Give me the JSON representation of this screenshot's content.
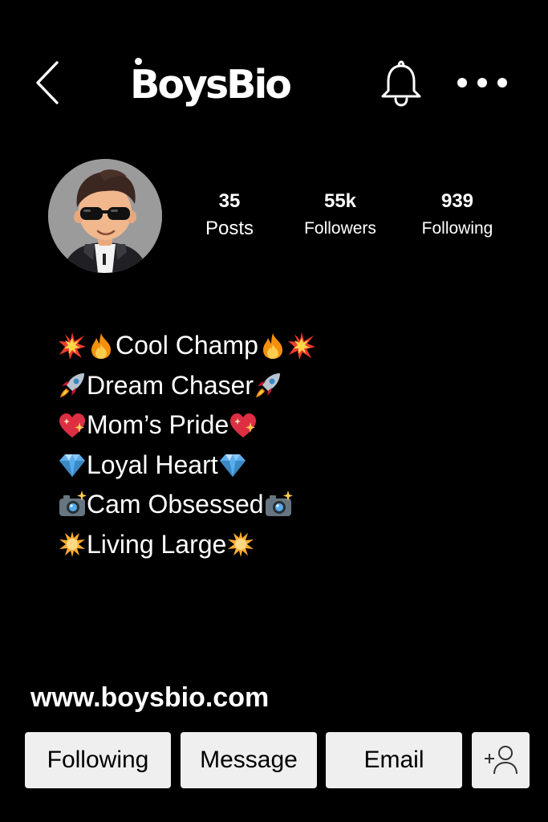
{
  "header": {
    "logo_text": "BoysBio",
    "icons": [
      "back-chevron-icon",
      "bell-icon",
      "more-dots-icon"
    ]
  },
  "profile": {
    "stats": [
      {
        "value": "35",
        "label": "Posts"
      },
      {
        "value": "55k",
        "label": "Followers"
      },
      {
        "value": "939",
        "label": "Following"
      }
    ],
    "bio": [
      {
        "lead_icon": "collision-icon",
        "second_icon": "fire-icon",
        "text": "Cool Champ",
        "trail_icons": [
          "fire-icon",
          "collision-icon"
        ]
      },
      {
        "lead_icon": "rocket-icon",
        "text": "Dream Chaser",
        "trail_icons": [
          "rocket-icon"
        ]
      },
      {
        "lead_icon": "sparkling-heart-icon",
        "text": "Mom’s Pride",
        "trail_icons": [
          "sparkling-heart-icon"
        ]
      },
      {
        "lead_icon": "gem-icon",
        "text": "Loyal Heart",
        "trail_icons": [
          "gem-icon"
        ]
      },
      {
        "lead_icon": "camera-flash-icon",
        "text": "Cam Obsessed",
        "trail_icons": [
          "camera-flash-icon"
        ]
      },
      {
        "lead_icon": "glowing-star-icon",
        "text": "Living Large",
        "trail_icons": [
          "glowing-star-icon"
        ]
      }
    ],
    "website": "www.boysbio.com"
  },
  "actions": {
    "following": "Following",
    "message": "Message",
    "email": "Email",
    "add_user_icon": "add-user-icon"
  },
  "colors": {
    "background": "#000000",
    "text": "#ffffff",
    "button_bg": "#efefef",
    "button_text": "#000000"
  }
}
